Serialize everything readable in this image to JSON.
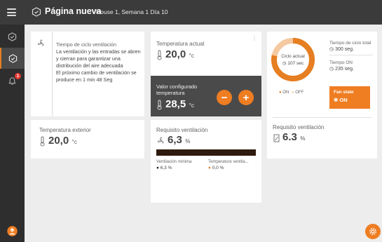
{
  "header": {
    "title": "Página nueva",
    "subtitle": "House 1, Semana 1 Día 10",
    "menu_icon": "hamburger-icon",
    "page_icon": "hexagon-check-icon"
  },
  "sidebar": {
    "items": [
      {
        "icon": "hexagon-check-icon"
      },
      {
        "icon": "hexagon-check-icon",
        "active": true
      },
      {
        "icon": "bell-icon",
        "badge": "1"
      }
    ],
    "user_icon": "avatar-icon"
  },
  "cards": {
    "ventilation_cycle": {
      "title": "Tiempo de ciclo ventilación",
      "text": "La ventilación y las entradas se abren y cierran para garantizar una distribución del aire adecuada",
      "next_change": "El próximo cambio de ventilación se produce en 1 min 48 Seg"
    },
    "current_temp": {
      "label": "Temperatura actual",
      "value": "20,0",
      "unit": "°c"
    },
    "configured_temp": {
      "label": "Valor configurado temperatura",
      "value": "28,5",
      "unit": "°c"
    },
    "cycle": {
      "current_label": "Ciclo actual",
      "current_value": "107 sec",
      "legend_on": "ON",
      "legend_off": "OFF",
      "total_label": "Tiempo de ciclo total",
      "total_value": "300 seg.",
      "on_label": "Tiempo ON",
      "on_value": "235 seg.",
      "fan_state_label": "Fan state",
      "fan_state_value": "ON",
      "on_fraction": 0.783,
      "colors": {
        "on": "#e67e22",
        "off": "#f4c9a0"
      }
    },
    "outside_temp": {
      "label": "Temperatura exterior",
      "value": "20,0",
      "unit": "°c"
    },
    "vent_requirement": {
      "label": "Requisito ventilación",
      "value": "6,3",
      "unit": "%",
      "min_label": "Ventilación mínima",
      "min_value": "6,3 %",
      "temp_label": "Temperature ventila...",
      "temp_value": "0,0 %"
    },
    "vent_requirement_2": {
      "label": "Requisito ventilación",
      "value": "6.3",
      "unit": "%"
    }
  }
}
